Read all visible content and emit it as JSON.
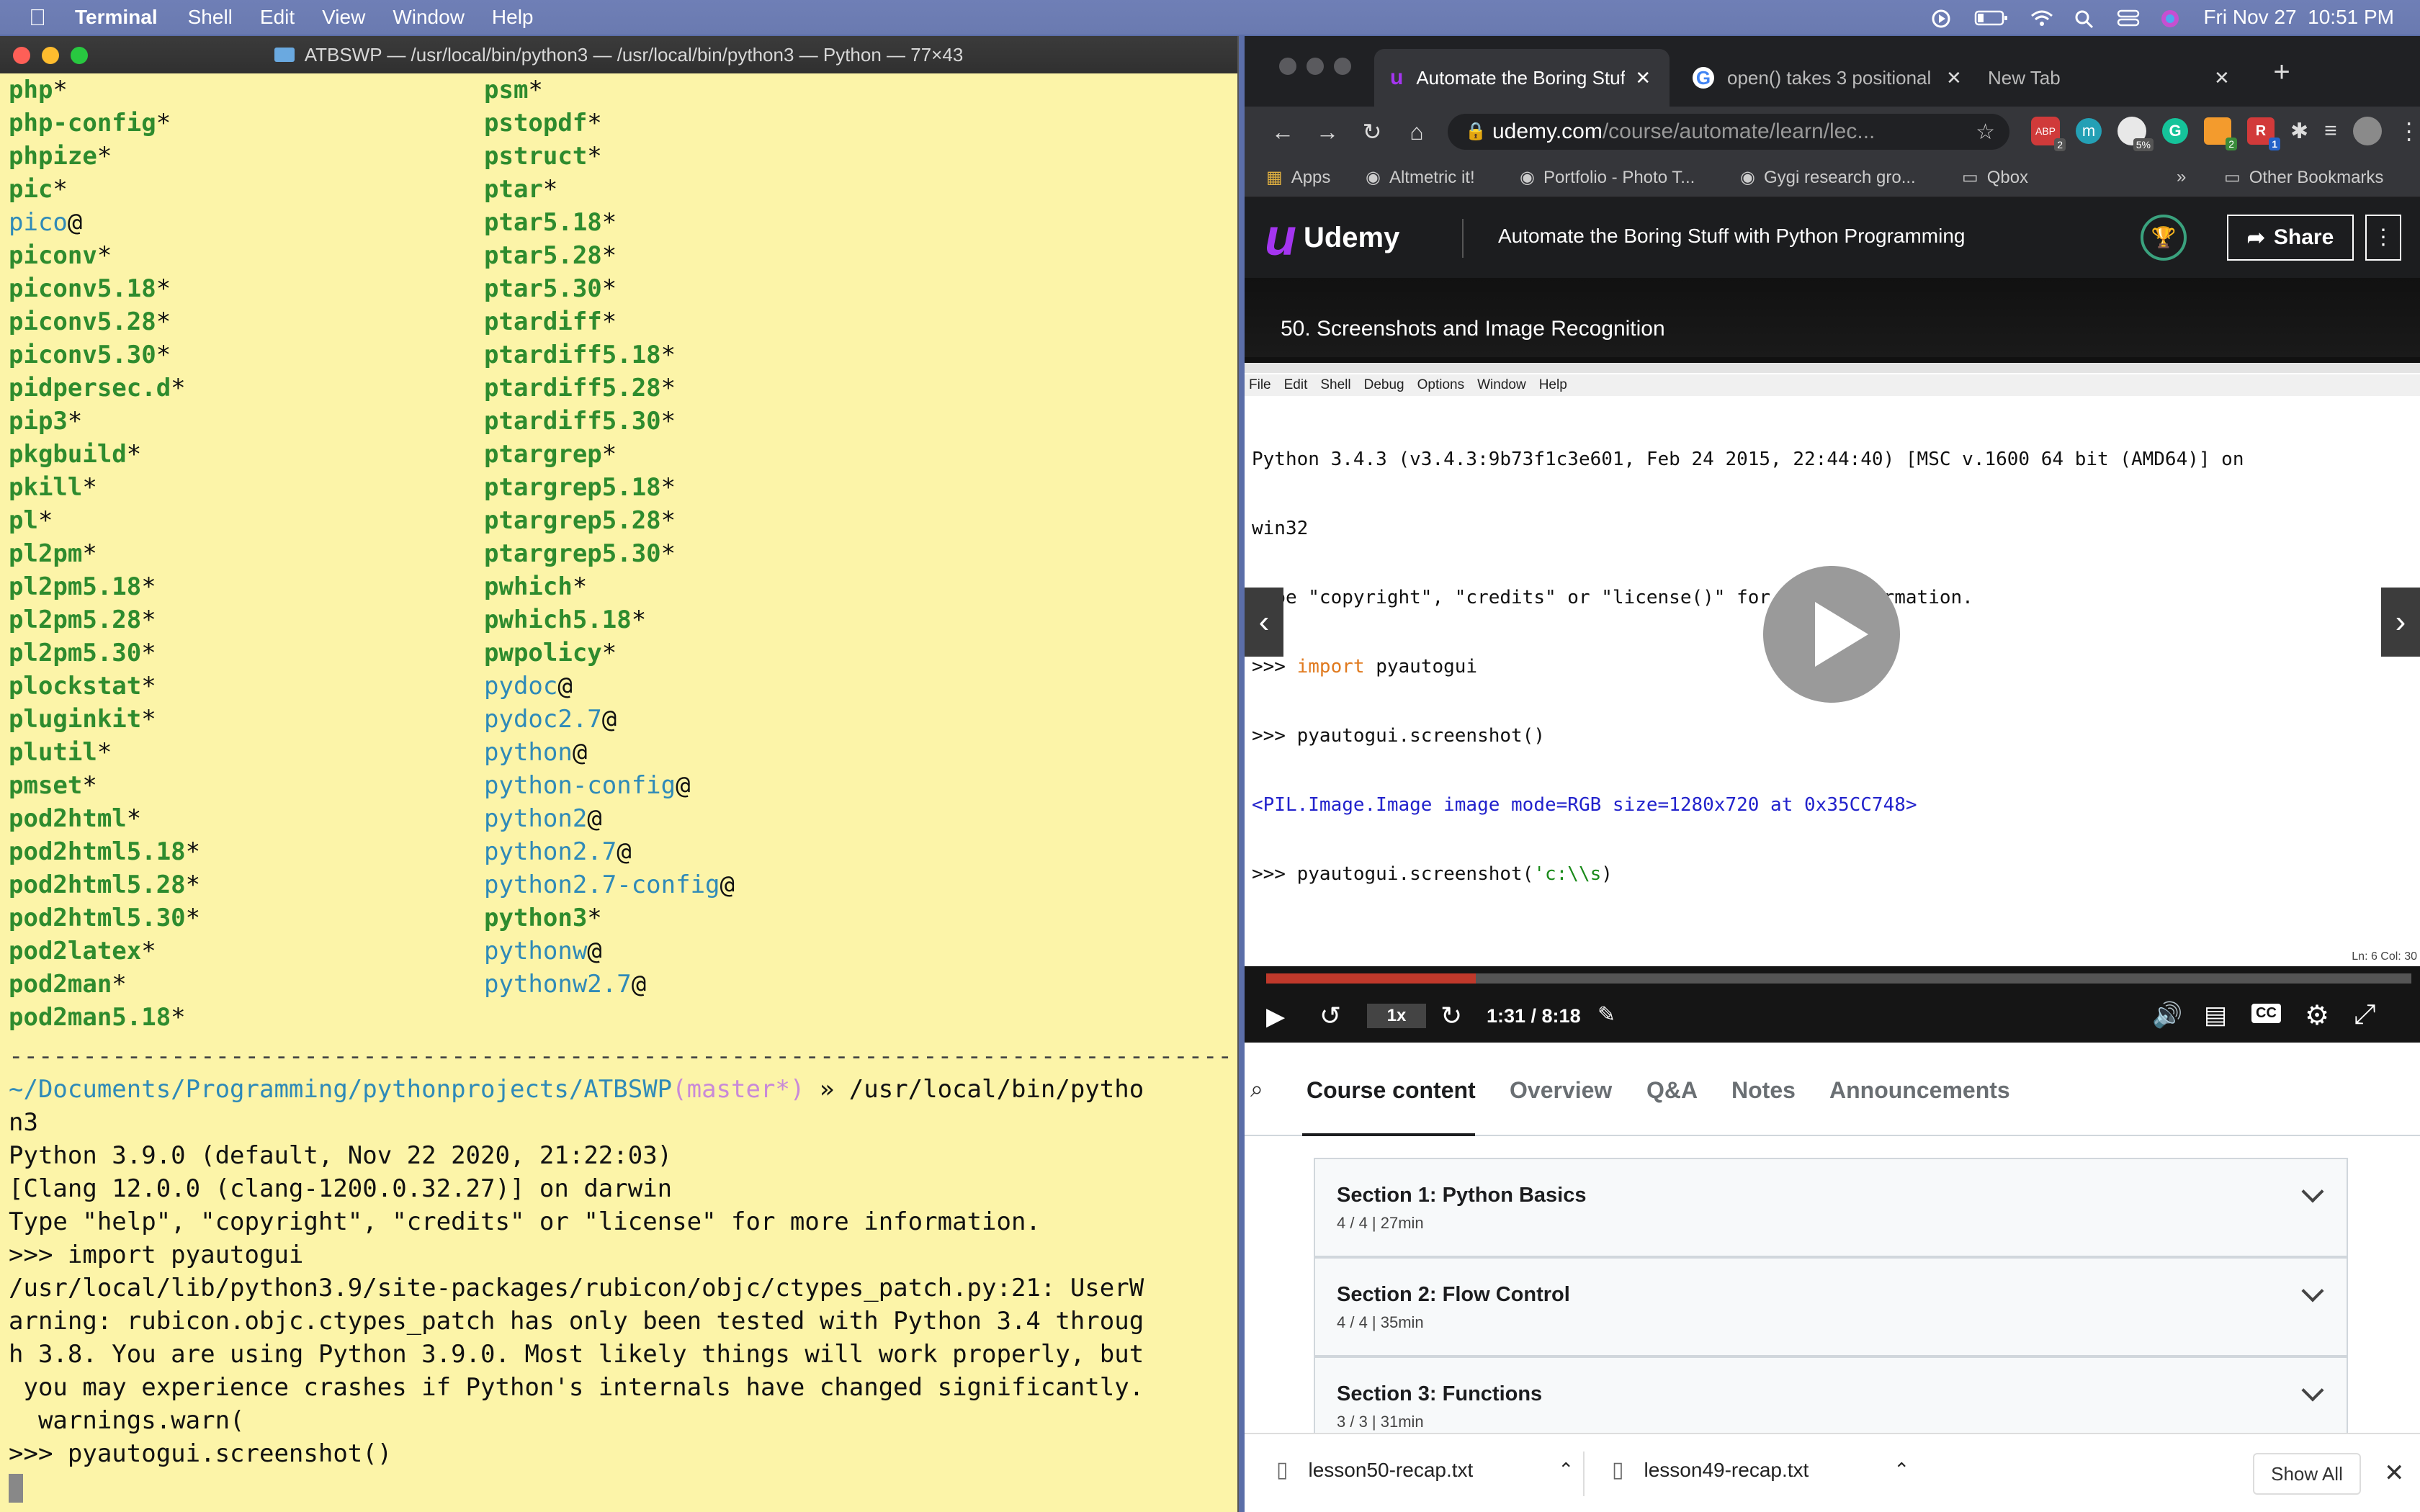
{
  "menubar": {
    "app": "Terminal",
    "items": [
      "Shell",
      "Edit",
      "View",
      "Window",
      "Help"
    ],
    "clock": "Fri Nov 27  10:51 PM"
  },
  "terminal": {
    "title": "ATBSWP — /usr/local/bin/python3 — /usr/local/bin/python3 — Python — 77×43",
    "left_col": [
      {
        "t": "php",
        "k": "exe",
        "s": "*"
      },
      {
        "t": "php-config",
        "k": "exe",
        "s": "*"
      },
      {
        "t": "phpize",
        "k": "exe",
        "s": "*"
      },
      {
        "t": "pic",
        "k": "exe",
        "s": "*"
      },
      {
        "t": "pico",
        "k": "lnk",
        "s": "@"
      },
      {
        "t": "piconv",
        "k": "exe",
        "s": "*"
      },
      {
        "t": "piconv5.18",
        "k": "exe",
        "s": "*"
      },
      {
        "t": "piconv5.28",
        "k": "exe",
        "s": "*"
      },
      {
        "t": "piconv5.30",
        "k": "exe",
        "s": "*"
      },
      {
        "t": "pidpersec.d",
        "k": "exe",
        "s": "*"
      },
      {
        "t": "pip3",
        "k": "exe",
        "s": "*"
      },
      {
        "t": "pkgbuild",
        "k": "exe",
        "s": "*"
      },
      {
        "t": "pkill",
        "k": "exe",
        "s": "*"
      },
      {
        "t": "pl",
        "k": "exe",
        "s": "*"
      },
      {
        "t": "pl2pm",
        "k": "exe",
        "s": "*"
      },
      {
        "t": "pl2pm5.18",
        "k": "exe",
        "s": "*"
      },
      {
        "t": "pl2pm5.28",
        "k": "exe",
        "s": "*"
      },
      {
        "t": "pl2pm5.30",
        "k": "exe",
        "s": "*"
      },
      {
        "t": "plockstat",
        "k": "exe",
        "s": "*"
      },
      {
        "t": "pluginkit",
        "k": "exe",
        "s": "*"
      },
      {
        "t": "plutil",
        "k": "exe",
        "s": "*"
      },
      {
        "t": "pmset",
        "k": "exe",
        "s": "*"
      },
      {
        "t": "pod2html",
        "k": "exe",
        "s": "*"
      },
      {
        "t": "pod2html5.18",
        "k": "exe",
        "s": "*"
      },
      {
        "t": "pod2html5.28",
        "k": "exe",
        "s": "*"
      },
      {
        "t": "pod2html5.30",
        "k": "exe",
        "s": "*"
      },
      {
        "t": "pod2latex",
        "k": "exe",
        "s": "*"
      },
      {
        "t": "pod2man",
        "k": "exe",
        "s": "*"
      },
      {
        "t": "pod2man5.18",
        "k": "exe",
        "s": "*"
      }
    ],
    "right_col": [
      {
        "t": "psm",
        "k": "exe",
        "s": "*"
      },
      {
        "t": "pstopdf",
        "k": "exe",
        "s": "*"
      },
      {
        "t": "pstruct",
        "k": "exe",
        "s": "*"
      },
      {
        "t": "ptar",
        "k": "exe",
        "s": "*"
      },
      {
        "t": "ptar5.18",
        "k": "exe",
        "s": "*"
      },
      {
        "t": "ptar5.28",
        "k": "exe",
        "s": "*"
      },
      {
        "t": "ptar5.30",
        "k": "exe",
        "s": "*"
      },
      {
        "t": "ptardiff",
        "k": "exe",
        "s": "*"
      },
      {
        "t": "ptardiff5.18",
        "k": "exe",
        "s": "*"
      },
      {
        "t": "ptardiff5.28",
        "k": "exe",
        "s": "*"
      },
      {
        "t": "ptardiff5.30",
        "k": "exe",
        "s": "*"
      },
      {
        "t": "ptargrep",
        "k": "exe",
        "s": "*"
      },
      {
        "t": "ptargrep5.18",
        "k": "exe",
        "s": "*"
      },
      {
        "t": "ptargrep5.28",
        "k": "exe",
        "s": "*"
      },
      {
        "t": "ptargrep5.30",
        "k": "exe",
        "s": "*"
      },
      {
        "t": "pwhich",
        "k": "exe",
        "s": "*"
      },
      {
        "t": "pwhich5.18",
        "k": "exe",
        "s": "*"
      },
      {
        "t": "pwpolicy",
        "k": "exe",
        "s": "*"
      },
      {
        "t": "pydoc",
        "k": "lnk",
        "s": "@"
      },
      {
        "t": "pydoc2.7",
        "k": "lnk",
        "s": "@"
      },
      {
        "t": "python",
        "k": "lnk",
        "s": "@"
      },
      {
        "t": "python-config",
        "k": "lnk",
        "s": "@"
      },
      {
        "t": "python2",
        "k": "lnk",
        "s": "@"
      },
      {
        "t": "python2.7",
        "k": "lnk",
        "s": "@"
      },
      {
        "t": "python2.7-config",
        "k": "lnk",
        "s": "@"
      },
      {
        "t": "python3",
        "k": "exe",
        "s": "*"
      },
      {
        "t": "pythonw",
        "k": "lnk",
        "s": "@"
      },
      {
        "t": "pythonw2.7",
        "k": "lnk",
        "s": "@"
      }
    ],
    "separator": "--------------------------------------------------------------------------------------------",
    "prompt_path": "~/Documents/Programming/pythonprojects/ATBSWP",
    "prompt_branch": "(master*)",
    "prompt_cmd": " » /usr/local/bin/pytho",
    "output": [
      "n3",
      "Python 3.9.0 (default, Nov 22 2020, 21:22:03)",
      "[Clang 12.0.0 (clang-1200.0.32.27)] on darwin",
      "Type \"help\", \"copyright\", \"credits\" or \"license\" for more information.",
      ">>> import pyautogui",
      "/usr/local/lib/python3.9/site-packages/rubicon/objc/ctypes_patch.py:21: UserW",
      "arning: rubicon.objc.ctypes_patch has only been tested with Python 3.4 throug",
      "h 3.8. You are using Python 3.9.0. Most likely things will work properly, but",
      " you may experience crashes if Python's internals have changed significantly.",
      "  warnings.warn(",
      ">>> pyautogui.screenshot()"
    ]
  },
  "browser": {
    "tabs": [
      "Automate the Boring Stuff",
      "open() takes 3 positional a",
      "New Tab"
    ],
    "url_host": "udemy.com",
    "url_path": "/course/automate/learn/lec...",
    "bookmarks": [
      "Apps",
      "Altmetric it!",
      "Portfolio - Photo T...",
      "Gygi research gro...",
      "Qbox",
      "Other Bookmarks"
    ],
    "extension_badges": [
      "2",
      "5%",
      "2",
      "1"
    ],
    "udemy": {
      "logo": "Udemy",
      "course_title": "Automate the Boring Stuff with Python Programming",
      "share": "Share",
      "lecture": "50. Screenshots and Image Recognition"
    },
    "idle": {
      "menu": [
        "File",
        "Edit",
        "Shell",
        "Debug",
        "Options",
        "Window",
        "Help"
      ],
      "lines": [
        "Python 3.4.3 (v3.4.3:9b73f1c3e601, Feb 24 2015, 22:44:40) [MSC v.1600 64 bit (AMD64)] on",
        "win32",
        "Type \"copyright\", \"credits\" or \"license()\" for more information."
      ],
      "prompt1": ">>> ",
      "import_kw": "import",
      "import_mod": " pyautogui",
      "line_shot": ">>> pyautogui.screenshot()",
      "result": "<PIL.Image.Image image mode=RGB size=1280x720 at 0x35CC748>",
      "line_save_pre": ">>> pyautogui.screenshot(",
      "line_save_str": "'c:\\\\s",
      "line_save_post": ")",
      "status": "Ln: 6 Col: 30"
    },
    "player": {
      "speed": "1x",
      "time": "1:31 / 8:18",
      "progress": 0.183
    },
    "course_tabs": [
      "Course content",
      "Overview",
      "Q&A",
      "Notes",
      "Announcements"
    ],
    "sections": [
      {
        "title": "Section 1: Python Basics",
        "meta": "4 / 4 | 27min"
      },
      {
        "title": "Section 2: Flow Control",
        "meta": "4 / 4 | 35min"
      },
      {
        "title": "Section 3: Functions",
        "meta": "3 / 3 | 31min"
      }
    ],
    "downloads": [
      "lesson50-recap.txt",
      "lesson49-recap.txt"
    ],
    "show_all": "Show All"
  },
  "colors": {
    "terminal_bg": "#fcf4a8",
    "exe": "#2e8b2e",
    "link": "#2f8ab8",
    "udemy_purple": "#a435f0"
  }
}
